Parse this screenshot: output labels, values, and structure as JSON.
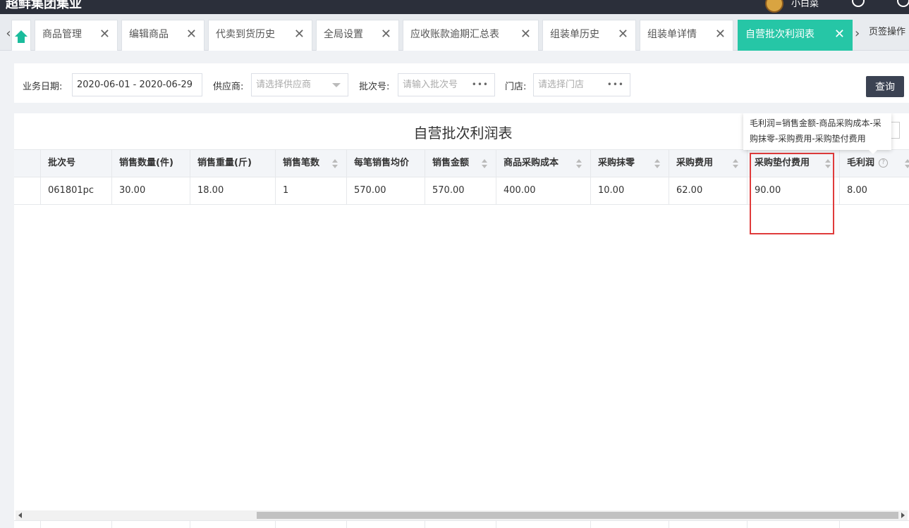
{
  "app": {
    "title": "超鲜集团集业",
    "user_name": "小白菜"
  },
  "tabs": [
    {
      "label": "商品管理"
    },
    {
      "label": "编辑商品"
    },
    {
      "label": "代卖到货历史"
    },
    {
      "label": "全局设置"
    },
    {
      "label": "应收账款逾期汇总表"
    },
    {
      "label": "组装单历史"
    },
    {
      "label": "组装单详情"
    },
    {
      "label": "自营批次利润表",
      "active": true
    }
  ],
  "tab_close_glyph": "✕",
  "tab_actions_label": "页签操作",
  "filters": {
    "date_label": "业务日期:",
    "date_value": "2020-06-01 - 2020-06-29",
    "supplier_label": "供应商:",
    "supplier_placeholder": "请选择供应商",
    "batch_label": "批次号:",
    "batch_placeholder": "请输入批次号",
    "store_label": "门店:",
    "store_placeholder": "请选择门店",
    "query_button": "查询"
  },
  "report": {
    "title": "自营批次利润表",
    "tooltip": "毛利润=销售金额-商品采购成本-采购抹零-采购费用-采购垫付费用",
    "columns": [
      "批次号",
      "销售数量(件)",
      "销售重量(斤)",
      "销售笔数",
      "每笔销售均价",
      "销售金额",
      "商品采购成本",
      "采购抹零",
      "采购费用",
      "采购垫付费用",
      "毛利润"
    ],
    "rows": [
      [
        "061801pc",
        "30.00",
        "18.00",
        "1",
        "570.00",
        "570.00",
        "400.00",
        "10.00",
        "62.00",
        "90.00",
        "8.00"
      ]
    ]
  },
  "colors": {
    "accent": "#26c6a6",
    "highlight": "#e03b3b",
    "button": "#3b4252"
  }
}
